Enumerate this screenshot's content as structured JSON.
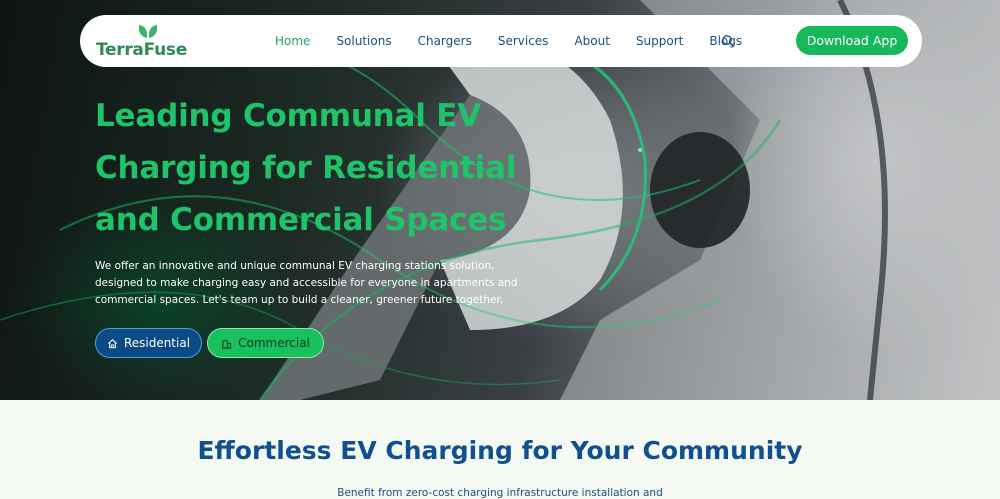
{
  "brand": {
    "name": "TerraFuse",
    "logo_icon": "leaf-icon"
  },
  "nav": {
    "items": [
      {
        "label": "Home",
        "active": true
      },
      {
        "label": "Solutions",
        "active": false
      },
      {
        "label": "Chargers",
        "active": false
      },
      {
        "label": "Services",
        "active": false
      },
      {
        "label": "About",
        "active": false
      },
      {
        "label": "Support",
        "active": false
      },
      {
        "label": "Blogs",
        "active": false
      }
    ],
    "search_icon": "search-icon",
    "cta_label": "Download App"
  },
  "hero": {
    "headline_lines": [
      "Leading Communal EV",
      "Charging for Residential",
      "and Commercial Spaces"
    ],
    "description_lines": [
      "We offer an innovative and unique communal EV charging stations solution,",
      "designed to make charging easy and accessible for everyone in apartments and",
      "commercial spaces. Let's team up to build a cleaner, greener future together."
    ],
    "buttons": [
      {
        "label": "Residential",
        "icon": "home-icon"
      },
      {
        "label": "Commercial",
        "icon": "building-icon"
      }
    ]
  },
  "section": {
    "title": "Effortless EV Charging for Your Community",
    "subtitle": "Benefit from zero-cost charging infrastructure installation and"
  },
  "colors": {
    "accent_green": "#1ec36a",
    "button_green": "#16b85a",
    "navy": "#0c4a86",
    "section_bg": "#f4f9f3"
  }
}
